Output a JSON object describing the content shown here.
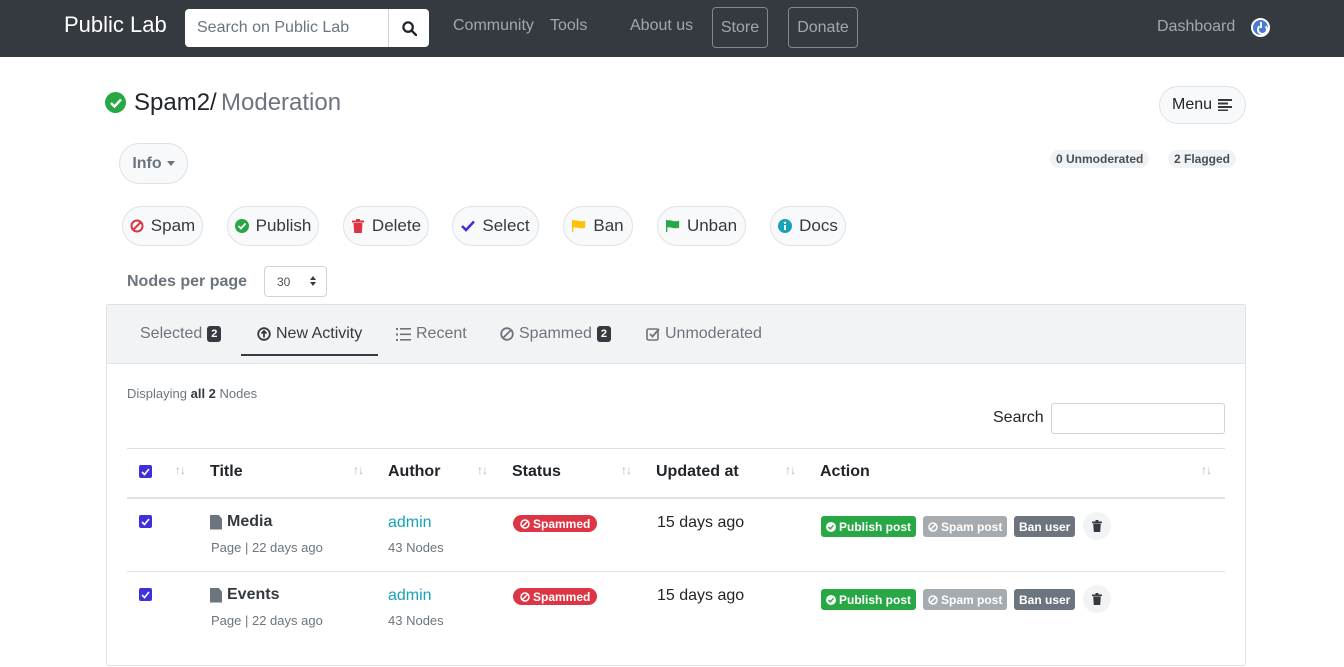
{
  "navbar": {
    "brand": "Public Lab",
    "search_placeholder": "Search on Public Lab",
    "links": [
      "Community",
      "Tools",
      "About us"
    ],
    "store": "Store",
    "donate": "Donate",
    "dashboard": "Dashboard"
  },
  "header": {
    "title": "Spam2/",
    "subtitle": "Moderation",
    "menu": "Menu",
    "info": "Info",
    "unmoderated": "0 Unmoderated",
    "flagged": "2 Flagged"
  },
  "actions": [
    "Spam",
    "Publish",
    "Delete",
    "Select",
    "Ban",
    "Unban",
    "Docs"
  ],
  "nodes_per_page": {
    "label": "Nodes per page",
    "value": "30"
  },
  "tabs": [
    {
      "label": "Selected",
      "count": "2"
    },
    {
      "label": "New Activity"
    },
    {
      "label": "Recent"
    },
    {
      "label": "Spammed",
      "count": "2"
    },
    {
      "label": "Unmoderated"
    }
  ],
  "listing": {
    "displaying_prefix": "Displaying",
    "displaying_all": "all 2",
    "displaying_suffix": "Nodes",
    "search_label": "Search"
  },
  "table": {
    "columns": [
      "Title",
      "Author",
      "Status",
      "Updated at",
      "Action"
    ],
    "rows": [
      {
        "title": "Media",
        "sub": "Page | 22 days ago",
        "author": "admin",
        "author_sub": "43 Nodes",
        "status": "Spammed",
        "updated": "15 days ago"
      },
      {
        "title": "Events",
        "sub": "Page | 22 days ago",
        "author": "admin",
        "author_sub": "43 Nodes",
        "status": "Spammed",
        "updated": "15 days ago"
      }
    ],
    "row_actions": {
      "publish": "Publish post",
      "spam": "Spam post",
      "ban": "Ban user"
    }
  },
  "colors": {
    "navbar": "#343a40",
    "success": "#28a745",
    "danger": "#dc3545",
    "info": "#17a2b8",
    "checkbox": "#3f30d8"
  }
}
